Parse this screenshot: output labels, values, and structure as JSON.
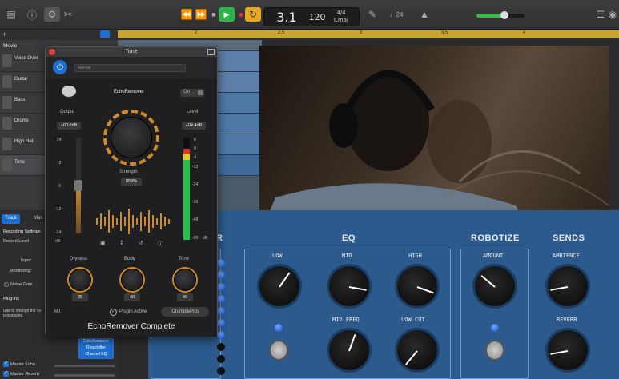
{
  "toolbar": {
    "position": "3.1",
    "tempo": "120",
    "time_sig": "4/4",
    "key": "Cmaj",
    "count_in": "♩24"
  },
  "ruler": {
    "marks": [
      "2",
      "2.5",
      "3",
      "3.5",
      "4"
    ]
  },
  "tracks": {
    "header": "Movie",
    "items": [
      {
        "label": "Voice Over"
      },
      {
        "label": "Guitar"
      },
      {
        "label": "Bass"
      },
      {
        "label": "Drums"
      },
      {
        "label": "High Hat"
      },
      {
        "label": "Tone"
      }
    ]
  },
  "inspector": {
    "tab_track": "Track",
    "tab_master": "Mas",
    "recording_settings": "Recording Settings",
    "record_level": "Record Level:",
    "input": "Input:",
    "monitoring": "Monitoring:",
    "noise_gate": "Noise Gate",
    "plugins": "Plug-ins",
    "plugins_hint1": "Use to change the so",
    "plugins_hint2": "processing.",
    "plugin_chain": [
      "EchoRemover",
      "Ringshifter",
      "Channel EQ"
    ],
    "master_echo": "Master Echo",
    "master_reverb": "Master Reverb"
  },
  "plugin": {
    "window_title": "Tone",
    "preset": "Manual",
    "name": "EchoRemover",
    "on_label": "On",
    "output_label": "Output",
    "output_value": "+00.0dB",
    "level_label": "Level",
    "level_value": "+04.4dB",
    "strength_label": "Strength",
    "strength_value": "059%",
    "output_scale": [
      "24",
      "12",
      "0",
      "-12",
      "-24"
    ],
    "output_unit": "dB",
    "level_scale": [
      "6",
      "0",
      "-6",
      "-12",
      "-24",
      "-36",
      "-48",
      "-60"
    ],
    "level_unit": "dB",
    "dryness_label": "Dryness",
    "dryness_value": "25",
    "body_label": "Body",
    "body_value": "40",
    "tone_label": "Tone",
    "tone_value": "40",
    "au_label": "AU",
    "active_label": "Plugin Active",
    "brand": "CrumplePop",
    "footer": "EchoRemover Complete"
  },
  "mixer": {
    "eq_title": "EQ",
    "robotize_title": "ROBOTIZE",
    "sends_title": "SENDS",
    "partial_title": "R",
    "low": "LOW",
    "mid": "MID",
    "high": "HIGH",
    "mid_freq": "MID FREQ",
    "low_cut": "LOW CUT",
    "amount": "AMOUNT",
    "ambience": "AMBIENCE",
    "reverb": "REVERB"
  },
  "colors": {
    "accent_blue": "#1e6fd0",
    "play_green": "#2db34a",
    "record_red": "#e03030",
    "cycle_yellow": "#e8a81e",
    "mixer_bg": "#2c5a8c",
    "ruler_yellow": "#c9a632"
  }
}
